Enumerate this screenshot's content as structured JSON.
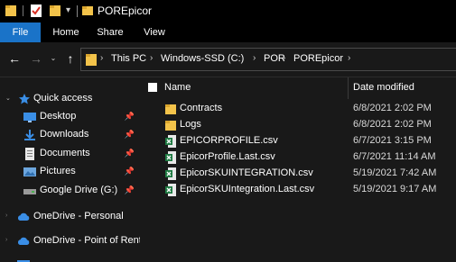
{
  "window": {
    "title": "POREpicor"
  },
  "ribbon": {
    "tabs": [
      "File",
      "Home",
      "Share",
      "View"
    ]
  },
  "nav": {
    "back": "←",
    "forward": "→",
    "recent": "⌄",
    "up": "↑"
  },
  "address": {
    "crumbs": [
      "This PC",
      "Windows-SSD (C:)",
      "POR",
      "POREpicor"
    ]
  },
  "navpane": {
    "quick_access": "Quick access",
    "items": [
      {
        "label": "Desktop",
        "icon": "desktop-icon",
        "pinned": true
      },
      {
        "label": "Downloads",
        "icon": "downloads-icon",
        "pinned": true
      },
      {
        "label": "Documents",
        "icon": "documents-icon",
        "pinned": true
      },
      {
        "label": "Pictures",
        "icon": "pictures-icon",
        "pinned": true
      },
      {
        "label": "Google Drive (G:)",
        "icon": "drive-icon",
        "pinned": true
      }
    ],
    "onedrive_personal": "OneDrive - Personal",
    "onedrive_business": "OneDrive - Point of Rental"
  },
  "list": {
    "columns": {
      "name": "Name",
      "date": "Date modified"
    },
    "rows": [
      {
        "name": "Contracts",
        "date": "6/8/2021 2:02 PM",
        "type": "folder"
      },
      {
        "name": "Logs",
        "date": "6/8/2021 2:02 PM",
        "type": "folder"
      },
      {
        "name": "EPICORPROFILE.csv",
        "date": "6/7/2021 3:15 PM",
        "type": "csv"
      },
      {
        "name": "EpicorProfile.Last.csv",
        "date": "6/7/2021 11:14 AM",
        "type": "csv"
      },
      {
        "name": "EpicorSKUINTEGRATION.csv",
        "date": "5/19/2021 7:42 AM",
        "type": "csv"
      },
      {
        "name": "EpicorSKUIntegration.Last.csv",
        "date": "5/19/2021 9:17 AM",
        "type": "csv"
      }
    ]
  },
  "colors": {
    "accent": "#1a73c8",
    "folder": "#f3c34a",
    "excel": "#1f7a42",
    "onedrive": "#3a8ee6"
  }
}
